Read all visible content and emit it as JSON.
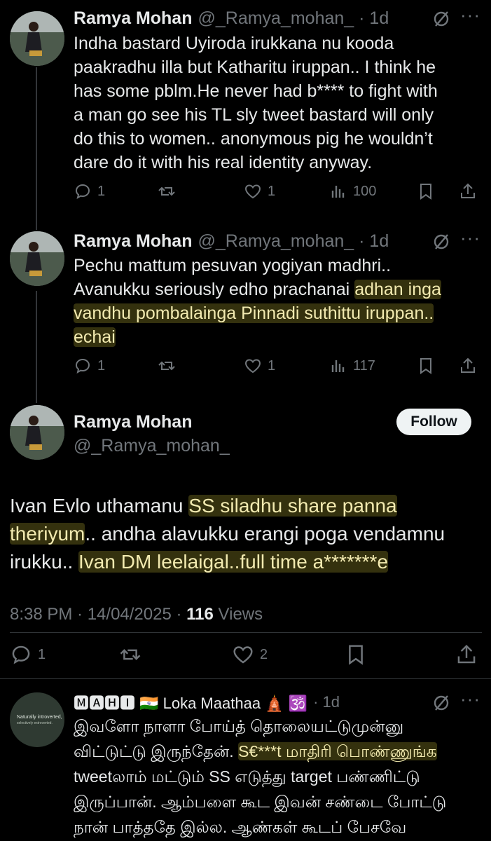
{
  "colors": {
    "background": "#000000",
    "text": "#e7e9ea",
    "muted": "#71767b",
    "highlight": "#f2eab0"
  },
  "tweet1": {
    "name": "Ramya Mohan",
    "handle": "@_Ramya_mohan_",
    "dot_time": "· 1d",
    "lines": [
      "Indha bastard Uyiroda irukkana nu kooda",
      "paakradhu illa but Katharitu iruppan.. I think he",
      "has some pblm.He  never had b**** to fight with",
      "a man go see his TL sly tweet bastard will only",
      "do this to women.. anonymous pig he wouldn’t",
      "dare do it with his real identity anyway."
    ],
    "replies": "1",
    "likes": "1",
    "views": "100"
  },
  "tweet2": {
    "name": "Ramya Mohan",
    "handle": "@_Ramya_mohan_",
    "dot_time": "· 1d",
    "line1": "Pechu mattum pesuvan yogiyan madhri..",
    "line2_plain": "Avanukku seriously edho prachanai ",
    "line2_hl": "adhan inga",
    "line3_hl": "vandhu pombalainga Pinnadi suthittu iruppan..",
    "line4_hl": "echai",
    "replies": "1",
    "likes": "1",
    "views": "117"
  },
  "main_tweet": {
    "name": "Ramya Mohan",
    "handle": "@_Ramya_mohan_",
    "follow_label": "Follow",
    "l1_plain": "Ivan Evlo uthamanu ",
    "l1_hl": "SS siladhu share panna",
    "l2_hl": "theriyum",
    "l2_plain": ".. andha alavukku erangi poga vendamnu",
    "l3_plain": "irukku.. ",
    "l3_hl": "Ivan DM leelaigal..full time a*******e",
    "timestamp": "8:38 PM · 14/04/2025 · ",
    "views_count": "116",
    "views_label": " Views",
    "replies": "1",
    "likes": "2"
  },
  "reply": {
    "name": "🅼🅰🅷🅸 🇮🇳 Loka Maathaa 🛕 🕉️",
    "dot_time": "· 1d",
    "avatar_line1": "Naturally introverted,",
    "avatar_line2": "selectively extroverted.",
    "lines": [
      "இவளோ நாளா போய்த் தொலையட்டுமுன்னு",
      "விட்டுட்டு இருந்தேன். ",
      "tweetலாம் மட்டும் SS எடுத்து target பண்ணிட்டு",
      "இருப்பான். ஆம்பளை கூட இவன் சண்டை போட்டு",
      "நான் பாத்ததே இல்ல. ஆண்கள் கூடப் பேசவே"
    ],
    "line2_hl": "S€***t மாதிரி பொண்ணுங்க"
  }
}
